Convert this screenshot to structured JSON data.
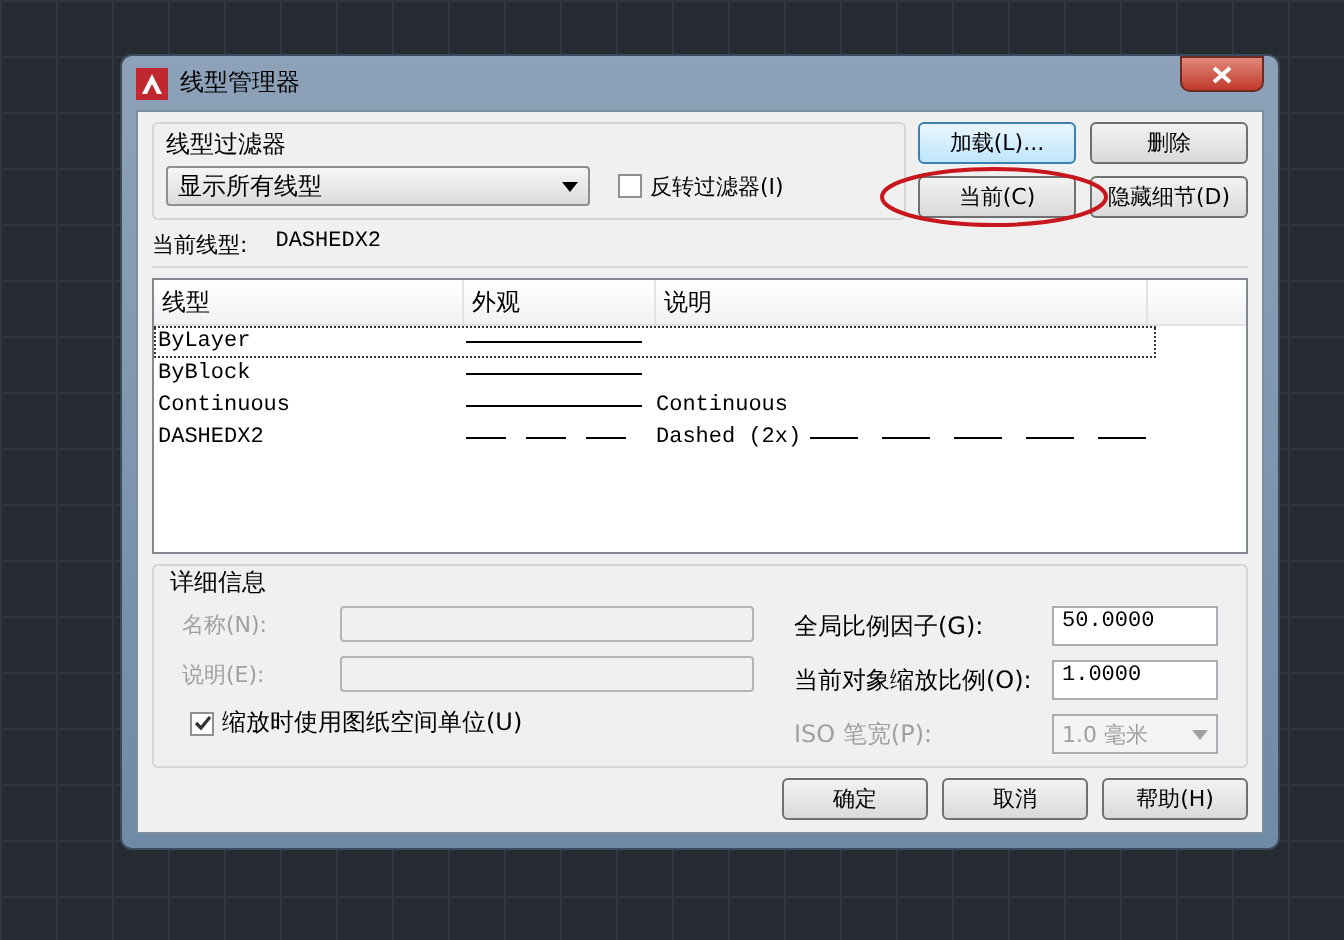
{
  "window": {
    "title": "线型管理器"
  },
  "filter": {
    "group_label": "线型过滤器",
    "dropdown_value": "显示所有线型",
    "invert_label": "反转过滤器(I)",
    "invert_checked": false
  },
  "buttons": [
    {
      "label": "加载(L)...",
      "default": true,
      "annotated": false
    },
    {
      "label": "删除",
      "default": false,
      "annotated": false
    },
    {
      "label": "当前(C)",
      "default": false,
      "annotated": true
    },
    {
      "label": "隐藏细节(D)",
      "default": false,
      "annotated": false
    }
  ],
  "current_linetype": {
    "label": "当前线型:",
    "value": "DASHEDX2"
  },
  "table": {
    "columns": [
      "线型",
      "外观",
      "说明"
    ],
    "rows": [
      {
        "name": "ByLayer",
        "kind": "solid",
        "description": "",
        "selected": true
      },
      {
        "name": "ByBlock",
        "kind": "solid",
        "description": "",
        "selected": false
      },
      {
        "name": "Continuous",
        "kind": "solid",
        "description": "Continuous",
        "selected": false
      },
      {
        "name": "DASHEDX2",
        "kind": "dashed",
        "description": "Dashed (2x)",
        "selected": false
      }
    ]
  },
  "details": {
    "group_label": "详细信息",
    "left_fields": [
      {
        "label": "名称(N):",
        "disabled": true
      },
      {
        "label": "说明(E):",
        "disabled": true
      }
    ],
    "paper_space_label": "缩放时使用图纸空间单位(U)",
    "paper_space_checked": true,
    "right_fields": [
      {
        "label": "全局比例因子(G):",
        "value": "50.0000",
        "kind": "input",
        "disabled": false
      },
      {
        "label": "当前对象缩放比例(O):",
        "value": "1.0000",
        "kind": "input",
        "disabled": false
      },
      {
        "label": "ISO 笔宽(P):",
        "value": "1.0 毫米",
        "kind": "dropdown",
        "disabled": true
      }
    ]
  },
  "footer_buttons": [
    "确定",
    "取消",
    "帮助(H)"
  ]
}
